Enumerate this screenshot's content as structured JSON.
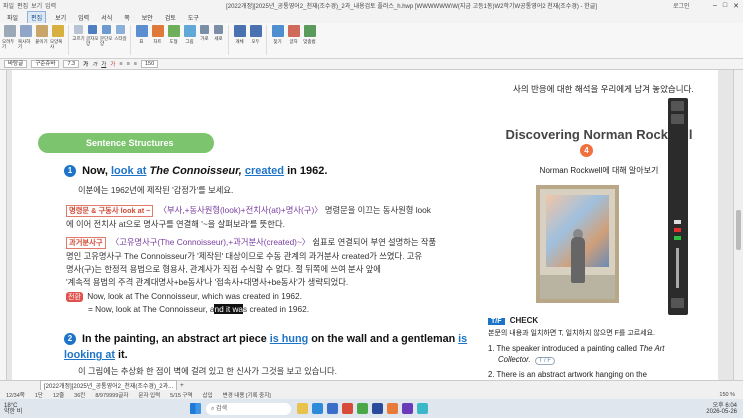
{
  "titlebar": {
    "title": "[2022개정][2025년_공통영어2_천재(조수경)_2과_내용검토 플러스_h.hwp [WWWWWW\\W(지금 고등1동)W2학기W공통영어2 천재(조수경) - 한글]",
    "login": "로그인",
    "quick": [
      "파일",
      "편집",
      "보기",
      "입력",
      "서식",
      "쪽",
      "보안",
      "검토",
      "도구"
    ]
  },
  "menu": [
    "파일",
    "편집",
    "보기",
    "입력",
    "서식",
    "쪽",
    "보안",
    "검토",
    "도구"
  ],
  "ribbon": [
    "오려두기",
    "복사하기",
    "붙이기",
    "모양복사",
    "고르기",
    "글자모양",
    "문단모양",
    "스타일",
    "표",
    "차트",
    "도형",
    "그림",
    "가로",
    "세로",
    "개체",
    "모두",
    "찾기",
    "글자",
    "맞춤법",
    "한자",
    "쪽 번호",
    "상용구",
    "책갈피",
    "메모"
  ],
  "fmtbar": {
    "style": "바탕글",
    "font": "구준쥬바",
    "size": "7.3",
    "zoom": "150"
  },
  "page": {
    "top_text": "사의 반응에 대한 해석을 우리에게 남겨 놓았습니다.",
    "section_title": "Sentence Structures",
    "s1": {
      "num": "1",
      "pre": "Now,",
      "link1": "look at",
      "italic": "The Connoisseur,",
      "link2": "created",
      "post": "in 1962."
    },
    "s1_translation": "이분에는 1962년에 제작된 '감정가'를 보세요.",
    "grammar1_tag": "명령문 & 구동사 look at ~",
    "grammar1_formula": "〈부사,+동사원형(look)+전치사(at)+명사(구)〉",
    "grammar1_text": "명령문을 이끄는 동사원형 look",
    "grammar1_line2": "에 이어 전치사 at으로 명사구를 연결해 '~을 살펴보라'를 뜻한다.",
    "grammar2_tag": "과거분사구",
    "grammar2_formula": "〈고유명사구(The Connoisseur),+과거분사(created)~〉",
    "grammar2_text": "쉼표로 연결되어 부연 설명하는 작품",
    "grammar2_line2": "명인 고유명사구 The Connoisseur가 '제작된' 대상이므로 수동 관계의 과거분사 created가 쓰였다. 고유",
    "grammar2_line3": "명사(구)는 한정적 용법으로 형용사, 관계사가 직접 수식할 수 없다. 절 뒤쪽에 쓰여 분사 앞에",
    "grammar2_line4": "'계속적 용법의 주격 관계대명사+be동사'나 '접속사+대명사+be동사'가 생략되었다.",
    "transform_tag": "전환",
    "transform1": "Now, look at The Connoisseur, which was created in 1962.",
    "transform2_pre": "= Now, look at The Connoisseur, a",
    "transform2_hl": "nd it wa",
    "transform2_post": "s created in 1962.",
    "s2": {
      "num": "2",
      "pre": "In the painting, an abstract art piece",
      "link1": "is hung",
      "mid": "on the wall and a gentleman",
      "link2": "is looking at",
      "post": "it."
    },
    "s2_translation": "이 그림에는 추상화 한 점이 벽에 걸려 있고 한 신사가 그것을 보고 있습니다.",
    "right": {
      "title": "Discovering Norman Rockwell",
      "num": "4",
      "subtitle": "Norman Rockwell에 대해 알아보기",
      "tf_tag": "T/F",
      "tf_title": "CHECK",
      "tf_instruction": "본문의 내용과 일치하면 T, 일치하지 않으면 F를 고르세요.",
      "q1_a": "1. The speaker introduced a painting called",
      "q1_b": "The Art",
      "q1_c": "Collector.",
      "q1_tf": "T / F",
      "q2": "2. There is an abstract artwork hanging on the"
    }
  },
  "doctab": "[2022개정][2025년_공통영어2_천재(조수경)_2과...",
  "status": {
    "page": "12/34쪽",
    "section": "1단",
    "line": "12줄",
    "col": "36칸",
    "chars": "8/979999글자",
    "mode": "문자 입력",
    "area": "5/15 구역",
    "insert": "삽입",
    "change": "변경 내용 [기록 중지]",
    "zoom": "150 %"
  },
  "taskbar": {
    "weather_temp": "18°C",
    "weather_desc": "약한 비",
    "search": "검색",
    "time": "오후 6:04",
    "date": "2026-05-26"
  },
  "colors": {
    "accent_blue": "#1d73c8",
    "section_green": "#7cc46e",
    "orange": "#f0703e",
    "red_tag": "#d04a35",
    "purple": "#7a3ea0"
  }
}
